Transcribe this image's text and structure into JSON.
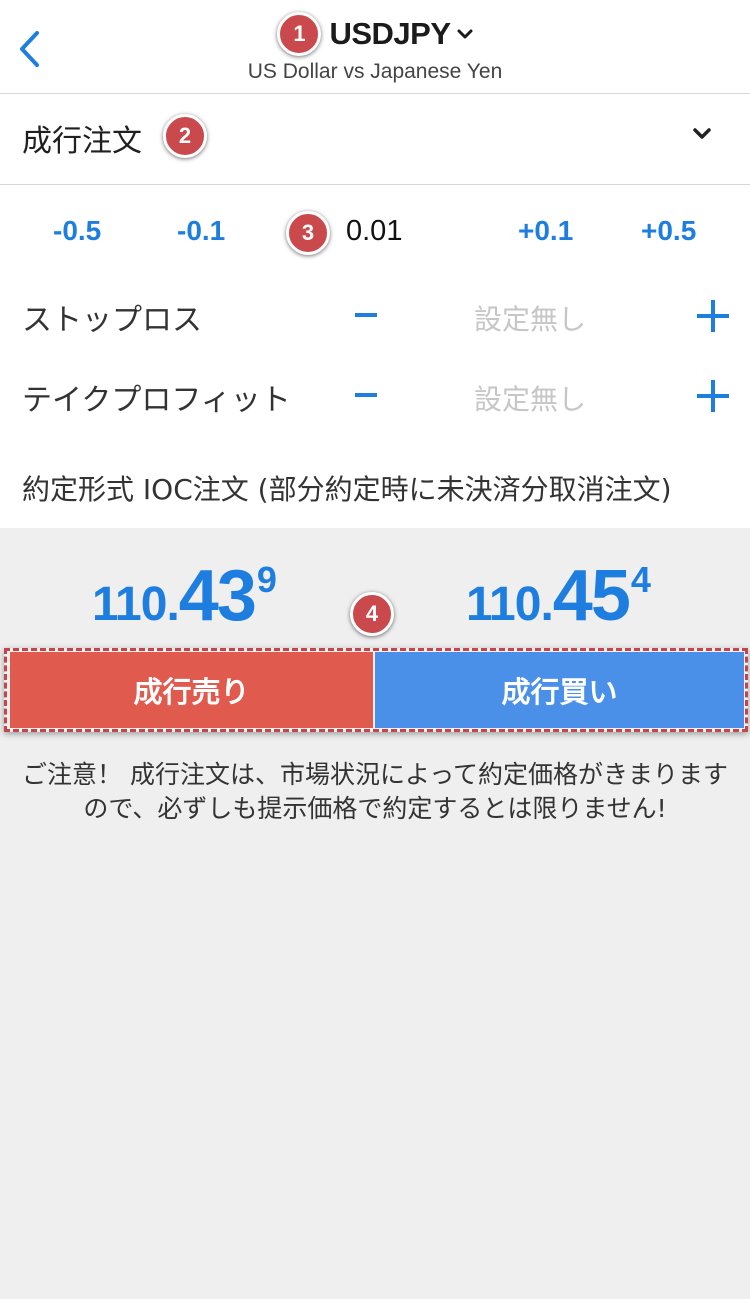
{
  "header": {
    "symbol": "USDJPY",
    "subtitle": "US Dollar vs Japanese Yen",
    "badge": "1"
  },
  "order_type": {
    "label": "成行注文",
    "badge": "2"
  },
  "volume": {
    "decrease_large": "-0.5",
    "decrease_small": "-0.1",
    "badge": "3",
    "value": "0.01",
    "increase_small": "+0.1",
    "increase_large": "+0.5"
  },
  "stop_loss": {
    "label": "ストップロス",
    "value": "設定無し"
  },
  "take_profit": {
    "label": "テイクプロフィット",
    "value": "設定無し"
  },
  "execution": {
    "text": "約定形式 IOC注文 (部分約定時に未決済分取消注文)"
  },
  "prices": {
    "bid": {
      "prefix": "110.",
      "big": "43",
      "sup": "9"
    },
    "ask": {
      "prefix": "110.",
      "big": "45",
      "sup": "4"
    },
    "badge": "4"
  },
  "buttons": {
    "sell": "成行売り",
    "buy": "成行買い"
  },
  "notice": "ご注意！ 成行注文は、市場状況によって約定価格がきまりますので、必ずしも提示価格で約定するとは限りません!",
  "colors": {
    "accent": "#1e7ee0",
    "sell": "#e05a4e",
    "buy": "#4a90e8",
    "badge": "#c9494d"
  }
}
